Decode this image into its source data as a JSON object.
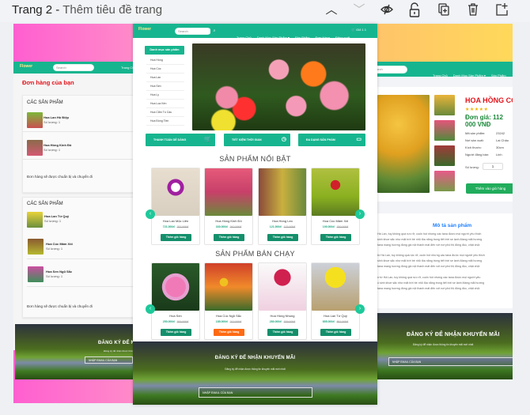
{
  "toolbar": {
    "page_label": "Trang 2 - ",
    "page_title": "Thêm tiêu đề trang",
    "icons": [
      "chevron-up-icon",
      "chevron-down-icon",
      "eye-off-icon",
      "unlock-icon",
      "duplicate-icon",
      "trash-icon",
      "add-page-icon"
    ]
  },
  "site": {
    "logo": "Flower",
    "search_placeholder": "Search",
    "nav": [
      "Trang Chủ",
      "Danh Mục Sản Phẩm ▾",
      "Sản Phẩm",
      "Đơn Hàng",
      "Đăng xuất"
    ],
    "cart_label": "Giỏ 1 1",
    "accent": "#17b58f"
  },
  "home": {
    "category_title": "Danh mục sản phẩm",
    "categories": [
      "Hoa Hồng",
      "Hoa Cúc",
      "Hoa Lan",
      "Hoa Sen",
      "Hoa Ly",
      "Hoa Loa Kèn",
      "Hoa Cẩm Tú Cầu",
      "Hoa Đồng Tiền"
    ],
    "features": [
      {
        "label": "THANH TOÁN DỄ DÀNG",
        "icon": "cart-icon"
      },
      {
        "label": "TIẾT KIỆM THỜI GIAN",
        "icon": "clock-icon"
      },
      {
        "label": "ĐA DẠNG SẢN PHẨM",
        "icon": "sofa-icon"
      }
    ],
    "featured_title": "SẢN PHẨM NỔI BẬT",
    "featured": [
      {
        "name": "Hoa Lan Mộc Liên",
        "price": "721.000đ",
        "old_price": "767.000đ"
      },
      {
        "name": "Hoa Hồng Kinh Đô",
        "price": "330.000đ",
        "old_price": "342.000đ"
      },
      {
        "name": "Hoa Hồng Leo",
        "price": "121.000đ",
        "old_price": "123.000đ"
      },
      {
        "name": "Hoa Cúc Mâm Xôi",
        "price": "190.000đ",
        "old_price": "200.000đ"
      }
    ],
    "bestseller_title": "SẢN PHẨM BÁN CHẠY",
    "bestsellers": [
      {
        "name": "Hoa Sen",
        "price": "250.000đ",
        "old_price": "300.000đ"
      },
      {
        "name": "Hoa Cúc Ngũ Sắc",
        "price": "185.000đ",
        "old_price": "212.000đ"
      },
      {
        "name": "Hoa Hồng Nhung",
        "price": "280.000đ",
        "old_price": "329.000đ"
      },
      {
        "name": "Hoa Lan Tứ Quý",
        "price": "855.000đ",
        "old_price": "867.000đ"
      }
    ],
    "add_to_cart": "Thêm giỏ hàng"
  },
  "footer": {
    "title": "ĐĂNG KÝ ĐỂ NHẬN KHUYẾN MÃI",
    "subtitle": "Đăng ký để nhận được thông tin khuyến mãi mới nhất",
    "email_placeholder": "NHẬP EMAIL CỦA BẠN"
  },
  "orders": {
    "title": "Đơn hàng của bạn",
    "section_title": "CÁC SẢN PHẨM",
    "note": "Đơn hàng sẽ được chuẩn bị và chuyển đi",
    "qty_label": "Số lượng: 1",
    "group1": [
      "Hoa Lan Hồ Điệp",
      "Hoa Hồng Kinh Đô"
    ],
    "group2": [
      "Hoa Lan Tứ Quý",
      "Hoa Cúc Mâm Xôi",
      "Hoa Sen Ngũ Sắc"
    ]
  },
  "detail": {
    "name": "HOA HỒNG CỔ",
    "rating": 5,
    "price": "Đơn giá: 112 000 VNĐ",
    "specs": [
      {
        "label": "Mã sản phẩm:",
        "value": "23242"
      },
      {
        "label": "Nơi sản xuất:",
        "value": "Lai Châu"
      },
      {
        "label": "Kích thước:",
        "value": "30cm"
      },
      {
        "label": "Người đăng bán:",
        "value": "Linh"
      }
    ],
    "qty_label": "Số lượng:",
    "qty_value": "1",
    "add_button": "Thêm vào giỏ hàng",
    "desc_title": "Mô tả sản phẩm",
    "desc_lines": [
      "Hà Lan, tuy không quá rực rỡ, cuốn hút nhưng các tana được mọi người yêu thích",
      "sinh khoe sắc như mặt trời bé nhỏ tỏa nắng trong tiết trời se lạnh.Mang mãi hương",
      "tana mang hương đồng gió nội thanh mát đến với nơi phố thị đông đúc, chật chội",
      "từ Hà Lan, tuy không quá rực rỡ, cuốn hút nhưng các tana được mọi người yêu thích",
      "sinh khoe sắc như mặt trời bé nhỏ tỏa nắng trong tiết trời se lạnh.Mang mãi hương",
      "tana mang hương đồng gió nội thanh mát đến với nơi phố thị đông đúc, chật chội",
      "ừ từ Hà Lan, tuy không quá rực rỡ, cuốn hút nhưng các tana được mọi người yêu",
      "ó sinh khoe sắc như mặt trời bé nhỏ tỏa nắng trong tiết trời se lạnh.Mang mãi hương",
      "tana mang hương đồng gió nội thanh mát đến với nơi phố thị đông đúc, chật chội"
    ]
  }
}
